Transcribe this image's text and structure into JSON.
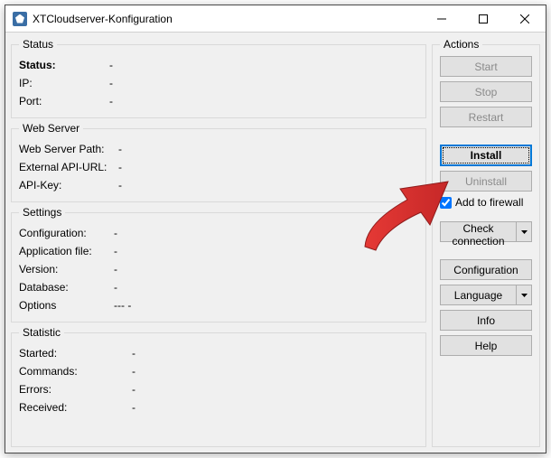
{
  "window": {
    "title": "XTCloudserver-Konfiguration"
  },
  "status": {
    "legend": "Status",
    "status_label": "Status:",
    "status_value": "-",
    "ip_label": "IP:",
    "ip_value": "-",
    "port_label": "Port:",
    "port_value": "-"
  },
  "webserver": {
    "legend": "Web Server",
    "path_label": "Web Server Path:",
    "path_value": "-",
    "ext_label": "External API-URL:",
    "ext_value": "-",
    "apikey_label": "API-Key:",
    "apikey_value": "-"
  },
  "settings": {
    "legend": "Settings",
    "config_label": "Configuration:",
    "config_value": "-",
    "appfile_label": "Application file:",
    "appfile_value": "-",
    "version_label": "Version:",
    "version_value": "-",
    "database_label": "Database:",
    "database_value": "-",
    "options_label": "Options",
    "options_value": "--- -"
  },
  "statistic": {
    "legend": "Statistic",
    "started_label": "Started:",
    "started_value": "-",
    "commands_label": "Commands:",
    "commands_value": "-",
    "errors_label": "Errors:",
    "errors_value": "-",
    "received_label": "Received:",
    "received_value": "-"
  },
  "actions": {
    "legend": "Actions",
    "start": "Start",
    "stop": "Stop",
    "restart": "Restart",
    "install": "Install",
    "uninstall": "Uninstall",
    "firewall_label": "Add to firewall",
    "firewall_checked": true,
    "check_connection": "Check connection",
    "configuration": "Configuration",
    "language": "Language",
    "info": "Info",
    "help": "Help"
  }
}
